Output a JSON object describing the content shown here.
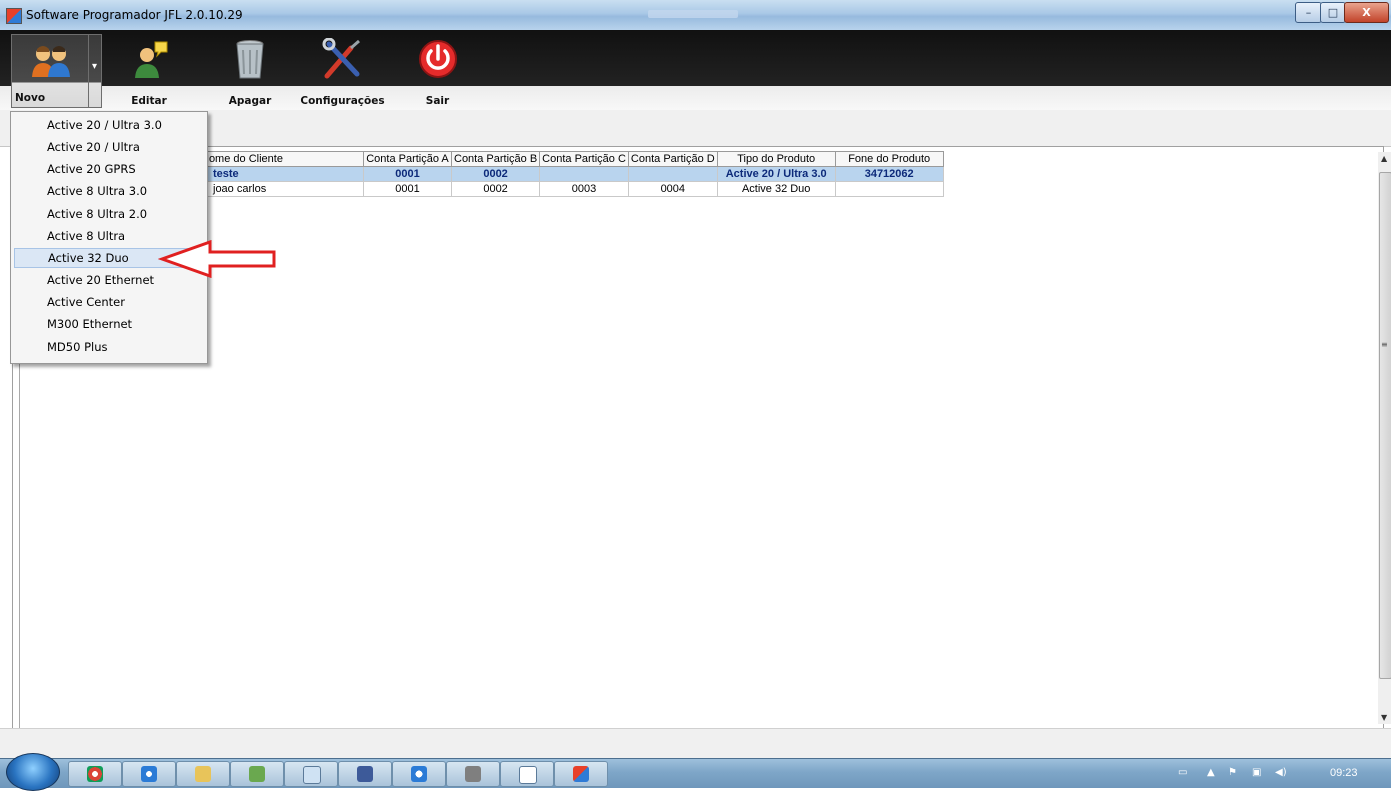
{
  "window": {
    "title": "Software Programador JFL 2.0.10.29",
    "min_label": "–",
    "max_label": "□",
    "close_label": "X"
  },
  "toolbar": {
    "novo": "Novo",
    "editar": "Editar",
    "apagar": "Apagar",
    "configuracoes": "Configurações",
    "sair": "Sair"
  },
  "menu_novo": {
    "items": [
      "Active 20 / Ultra 3.0",
      "Active 20 / Ultra",
      "Active 20 GPRS",
      "Active 8 Ultra 3.0",
      "Active 8 Ultra 2.0",
      "Active 8 Ultra",
      "Active 32 Duo",
      "Active 20 Ethernet",
      "Active Center",
      "M300 Ethernet",
      "MD50 Plus"
    ],
    "highlighted_index": 6
  },
  "table": {
    "columns": [
      "Nome do Cliente",
      "Conta Partição A",
      "Conta Partição B",
      "Conta Partição C",
      "Conta Partição D",
      "Tipo do Produto",
      "Fone do Produto"
    ],
    "rows": [
      [
        "teste",
        "0001",
        "0002",
        "",
        "",
        "Active 20 / Ultra 3.0",
        "34712062"
      ],
      [
        "joao carlos",
        "0001",
        "0002",
        "0003",
        "0004",
        "Active 32 Duo",
        ""
      ]
    ],
    "selected_row": 0
  },
  "taskbar": {
    "clock": "09:23"
  },
  "colors": {
    "annotation_arrow": "#e02020",
    "selected_row_bg": "#b9d4ee",
    "selected_row_text": "#0d2a7a"
  }
}
